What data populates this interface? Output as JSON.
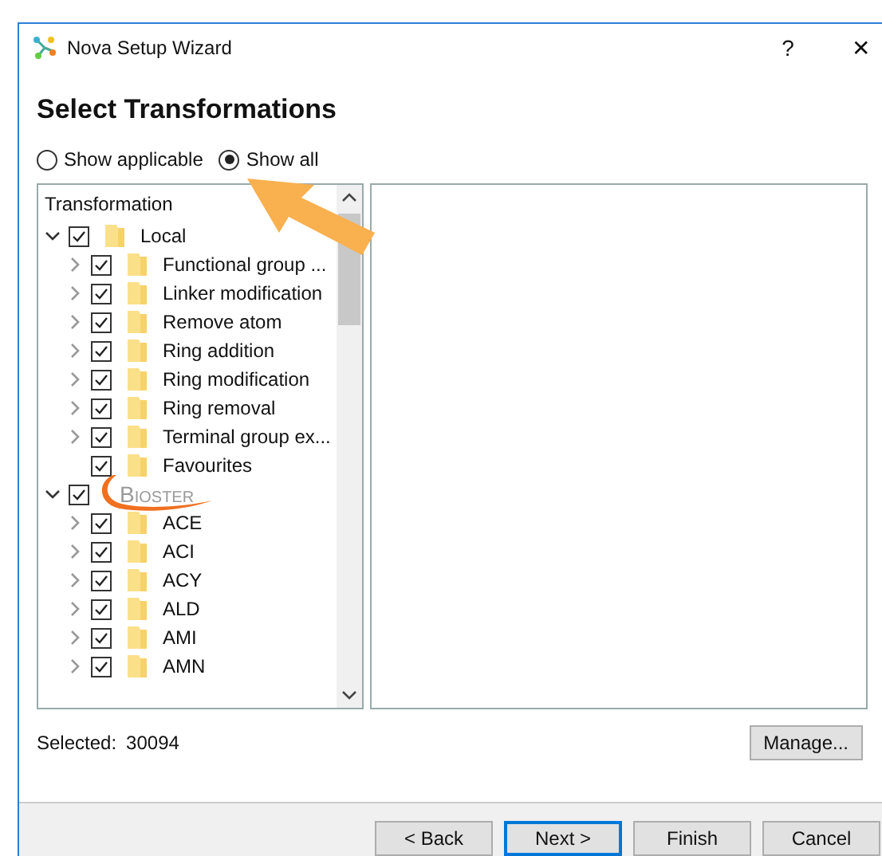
{
  "window": {
    "title": "Nova Setup Wizard",
    "help": "?",
    "close": "✕"
  },
  "heading": "Select Transformations",
  "filter": [
    {
      "label": "Show applicable",
      "selected": false
    },
    {
      "label": "Show all",
      "selected": true
    }
  ],
  "tree": {
    "column": "Transformation",
    "items": [
      {
        "kind": "folder",
        "label": "Local",
        "checked": true,
        "expanded": true,
        "children": [
          {
            "kind": "folder",
            "label": "Functional group ...",
            "checked": true,
            "expanded": false,
            "has_children": true
          },
          {
            "kind": "folder",
            "label": "Linker modification",
            "checked": true,
            "expanded": false,
            "has_children": true
          },
          {
            "kind": "folder",
            "label": "Remove atom",
            "checked": true,
            "expanded": false,
            "has_children": true
          },
          {
            "kind": "folder",
            "label": "Ring addition",
            "checked": true,
            "expanded": false,
            "has_children": true
          },
          {
            "kind": "folder",
            "label": "Ring modification",
            "checked": true,
            "expanded": false,
            "has_children": true
          },
          {
            "kind": "folder",
            "label": "Ring removal",
            "checked": true,
            "expanded": false,
            "has_children": true
          },
          {
            "kind": "folder",
            "label": "Terminal group ex...",
            "checked": true,
            "expanded": false,
            "has_children": true
          },
          {
            "kind": "folder",
            "label": "Favourites",
            "checked": true,
            "expanded": false,
            "has_children": false
          }
        ]
      },
      {
        "kind": "logo",
        "label": "Bioster",
        "checked": true,
        "expanded": true,
        "children": [
          {
            "kind": "folder",
            "label": "ACE",
            "checked": true,
            "expanded": false,
            "has_children": true
          },
          {
            "kind": "folder",
            "label": "ACI",
            "checked": true,
            "expanded": false,
            "has_children": true
          },
          {
            "kind": "folder",
            "label": "ACY",
            "checked": true,
            "expanded": false,
            "has_children": true
          },
          {
            "kind": "folder",
            "label": "ALD",
            "checked": true,
            "expanded": false,
            "has_children": true
          },
          {
            "kind": "folder",
            "label": "AMI",
            "checked": true,
            "expanded": false,
            "has_children": true
          },
          {
            "kind": "folder",
            "label": "AMN",
            "checked": true,
            "expanded": false,
            "has_children": true
          }
        ]
      }
    ]
  },
  "selected_label": "Selected:",
  "selected_count": "30094",
  "manage_button": "Manage...",
  "buttons": [
    {
      "label": "< Back",
      "default": false
    },
    {
      "label": "Next >",
      "default": true
    },
    {
      "label": "Finish",
      "default": false
    },
    {
      "label": "Cancel",
      "default": false
    }
  ]
}
